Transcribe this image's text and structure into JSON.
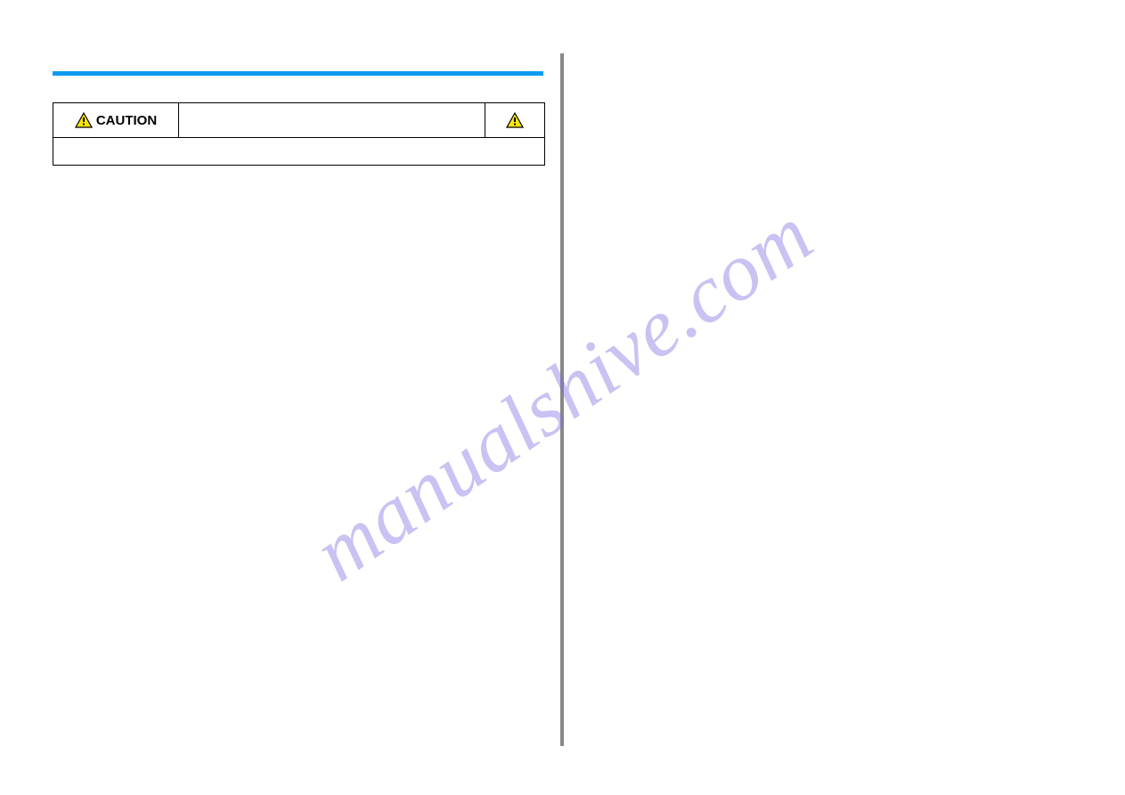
{
  "watermark": "manualshive.com",
  "caution": {
    "label": "CAUTION",
    "icon_left": "warning-triangle",
    "icon_right": "warning-triangle"
  }
}
